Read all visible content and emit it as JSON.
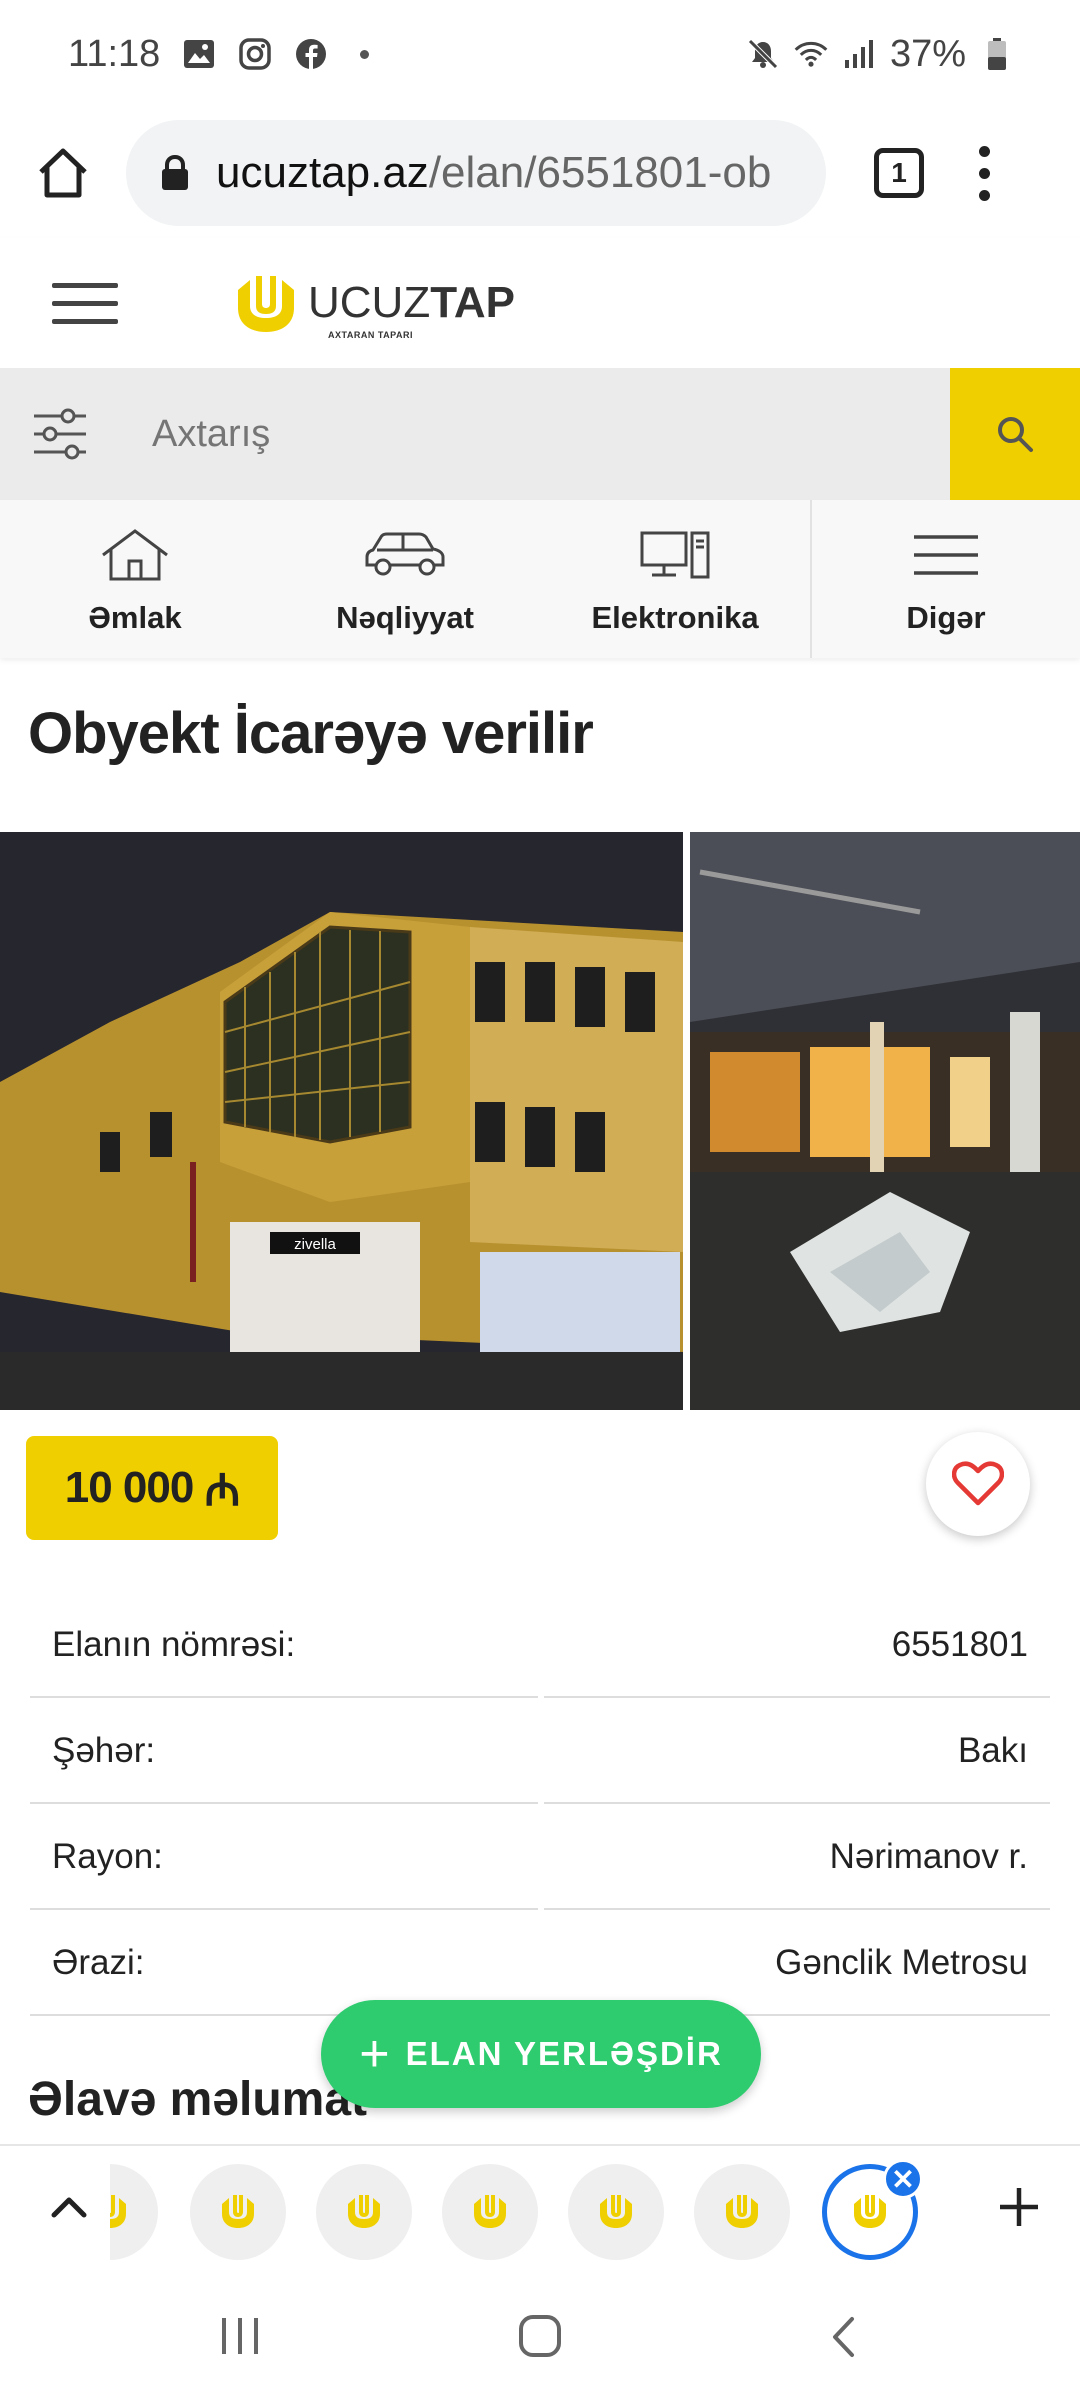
{
  "status_bar": {
    "time": "11:18",
    "battery": "37%",
    "icons": [
      "gallery-icon",
      "instagram-icon",
      "facebook-icon",
      "mute-icon",
      "wifi-icon",
      "signal-icon",
      "battery-icon"
    ]
  },
  "browser": {
    "url_domain": "ucuztap.az",
    "url_path": "/elan/6551801-ob",
    "tab_count": "1"
  },
  "site": {
    "logo_text_light": "UCUZ",
    "logo_text_bold": "TAP",
    "logo_tagline": "AXTARAN TAPARI"
  },
  "search": {
    "placeholder": "Axtarış"
  },
  "categories": [
    {
      "label": "Əmlak",
      "icon": "house-icon"
    },
    {
      "label": "Nəqliyyat",
      "icon": "car-icon"
    },
    {
      "label": "Elektronika",
      "icon": "computer-icon"
    },
    {
      "label": "Digər",
      "icon": "menu-lines-icon"
    }
  ],
  "listing": {
    "title": "Obyekt İcarəyə verilir",
    "price": "10 000",
    "currency_symbol": "₼",
    "details": [
      {
        "label": "Elanın nömrəsi:",
        "value": "6551801"
      },
      {
        "label": "Şəhər:",
        "value": "Bakı"
      },
      {
        "label": "Rayon:",
        "value": "Nərimanov r."
      },
      {
        "label": "Ərazi:",
        "value": "Gənclik Metrosu"
      }
    ],
    "more_info_title": "Əlavə məlumat",
    "photo_sign_text": "zivella"
  },
  "post_ad_button": {
    "plus": "+",
    "label": "ELAN YERLƏŞDİR"
  },
  "tab_strip": {
    "close_symbol": "✕"
  },
  "colors": {
    "brand_yellow": "#f0cf00",
    "post_green": "#2ecc6f",
    "heart_red": "#e53935",
    "tab_blue": "#1a73e8"
  }
}
